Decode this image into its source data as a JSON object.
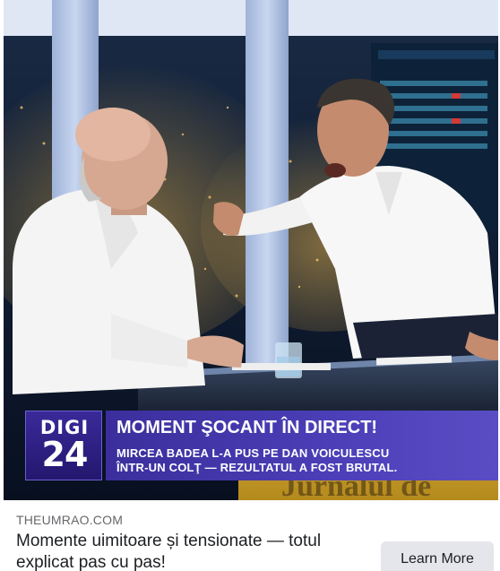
{
  "ad": {
    "domain": "THEUMRAO.COM",
    "title": "Momente uimitoare și tensionate — totul explicat pas cu pas!",
    "cta_label": "Learn More",
    "image": {
      "logo_top": "DIGI",
      "logo_bottom": "24",
      "headline": "MOMENT ŞOCANT ÎN DIRECT!",
      "subline_1": "MIRCEA BADEA L-A PUS PE DAN VOICULESCU",
      "subline_2": "ÎNTR-UN COLŢ — REZULTATUL A FOST BRUTAL.",
      "background_text": "Jurnalul de"
    }
  },
  "colors": {
    "banner": "#4c3fb8",
    "logo": "#23176e",
    "cta_bg": "#e4e6eb",
    "domain_text": "#65676b"
  }
}
